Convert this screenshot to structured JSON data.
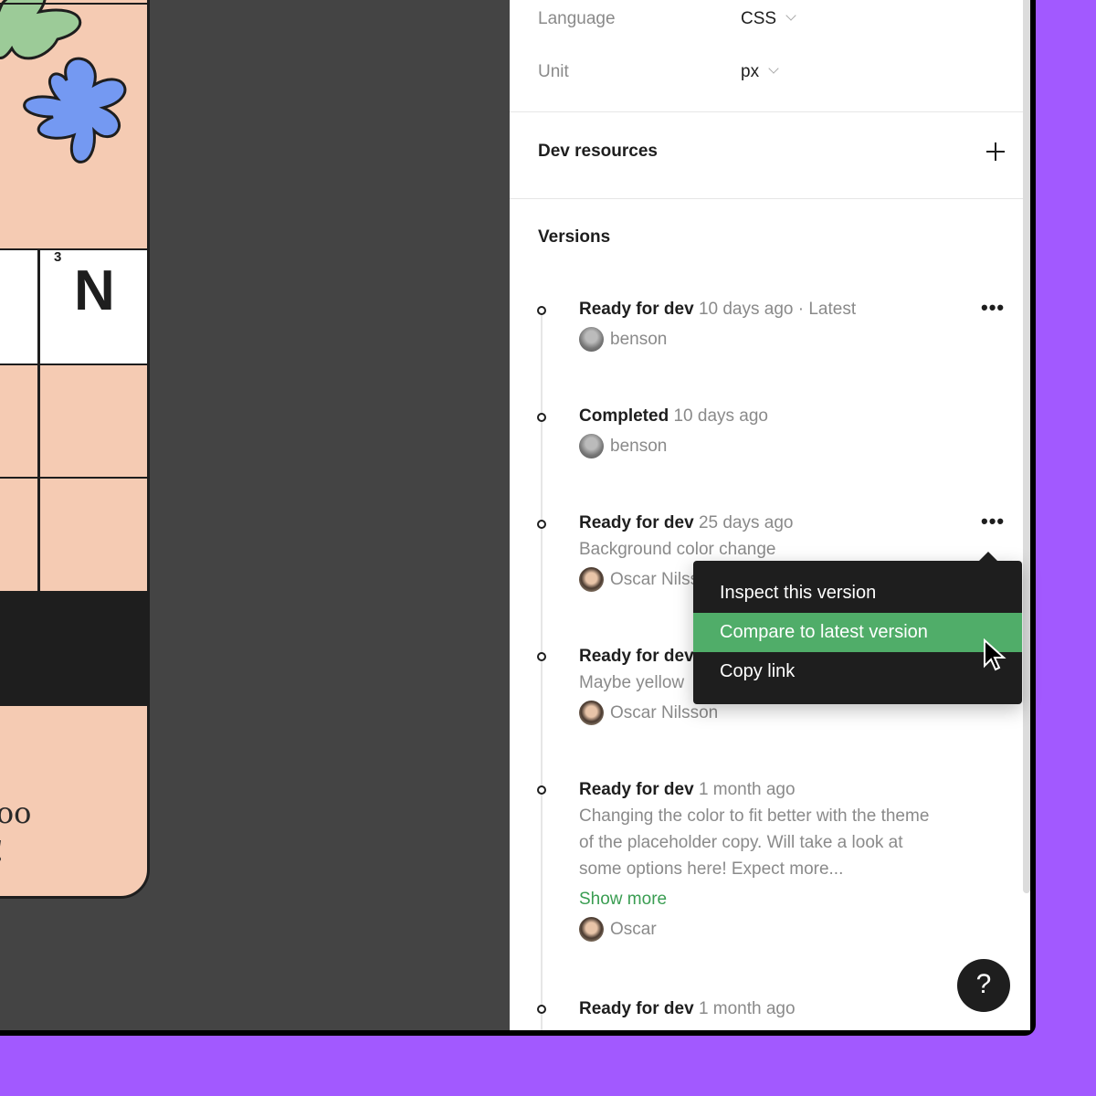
{
  "canvas": {
    "cell_number": "3",
    "cell_letter": "N",
    "text_line1": "too",
    "text_line2": "!"
  },
  "settings": {
    "language_label": "Language",
    "language_value": "CSS",
    "unit_label": "Unit",
    "unit_value": "px"
  },
  "dev_resources": {
    "title": "Dev resources",
    "add_icon": "plus-icon"
  },
  "versions": {
    "title": "Versions",
    "items": [
      {
        "status": "Ready for dev",
        "time": "10 days ago",
        "tag": "· Latest",
        "user": "benson"
      },
      {
        "status": "Completed",
        "time": "10 days ago",
        "user": "benson"
      },
      {
        "status": "Ready for dev",
        "time": "25 days ago",
        "description": "Background color change",
        "user": "Oscar Nilsson"
      },
      {
        "status": "Ready for dev",
        "time": "",
        "description": "Maybe yellow",
        "user": "Oscar Nilsson"
      },
      {
        "status": "Ready for dev",
        "time": "1 month ago",
        "description": "Changing the color to fit better with the theme of the placeholder copy. Will take a look at some options here! Expect more...",
        "show_more": "Show more",
        "user": "Oscar"
      },
      {
        "status": "Ready for dev",
        "time": "1 month ago"
      }
    ]
  },
  "context_menu": {
    "items": [
      "Inspect this version",
      "Compare to latest version",
      "Copy link"
    ],
    "active_index": 1,
    "active_color": "#50ad69"
  },
  "help": {
    "label": "?"
  },
  "colors": {
    "background": "#a259ff",
    "canvas": "#444444",
    "board": "#f5cbb3"
  }
}
